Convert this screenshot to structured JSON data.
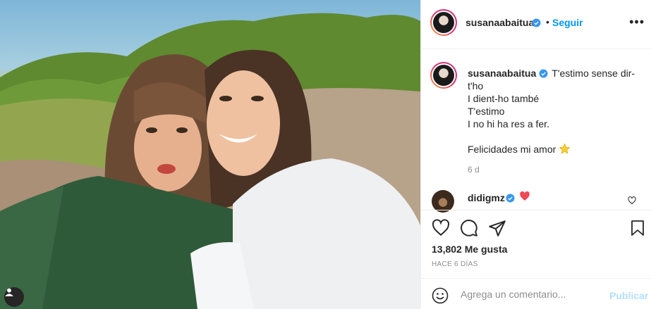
{
  "post": {
    "author": "susanaabaitua",
    "follow_label": "Seguir",
    "separator": "•",
    "more_icon": "more-horizontal-icon"
  },
  "caption": {
    "username": "susanaabaitua",
    "text": "T'estimo sense dir-t'ho\nI dient-ho també\nT'estimo\nI no hi ha res a fer.\n\nFelicidades mi amor",
    "emoji": "star-icon",
    "time": "6 d"
  },
  "comments": [
    {
      "username": "didigmz",
      "emoji": "red-heart-icon"
    }
  ],
  "stats": {
    "likes": "13,802 Me gusta",
    "ago": "HACE 6 DÍAS"
  },
  "comment_box": {
    "placeholder": "Agrega un comentario...",
    "publish_label": "Publicar"
  },
  "colors": {
    "accent": "#0095f6",
    "publish_disabled": "#b2dffc",
    "heart_red": "#ed4956",
    "border": "#efefef",
    "secondary_text": "#8e8e8e"
  }
}
